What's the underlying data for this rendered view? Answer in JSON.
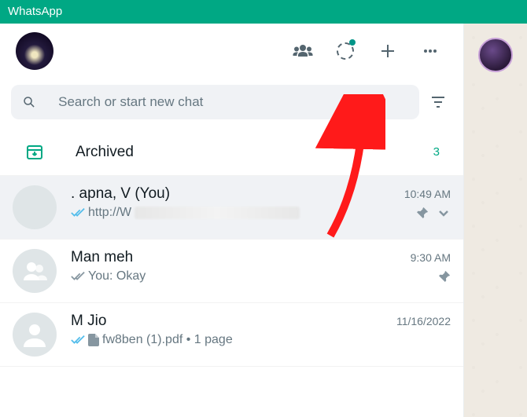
{
  "window": {
    "title": "WhatsApp"
  },
  "search": {
    "placeholder": "Search or start new chat"
  },
  "archived": {
    "label": "Archived",
    "count": "3"
  },
  "chats": [
    {
      "name": ". apna, V (You)",
      "time": "10:49 AM",
      "ticks": "read",
      "preview_prefix": "http://W",
      "pinned": true,
      "chevron": true
    },
    {
      "name": "Man meh",
      "time": "9:30 AM",
      "ticks": "delivered",
      "preview": "You: Okay",
      "pinned": true
    },
    {
      "name": "M Jio",
      "time": "11/16/2022",
      "ticks": "read",
      "doc": true,
      "preview": "fw8ben (1).pdf • 1 page"
    }
  ]
}
